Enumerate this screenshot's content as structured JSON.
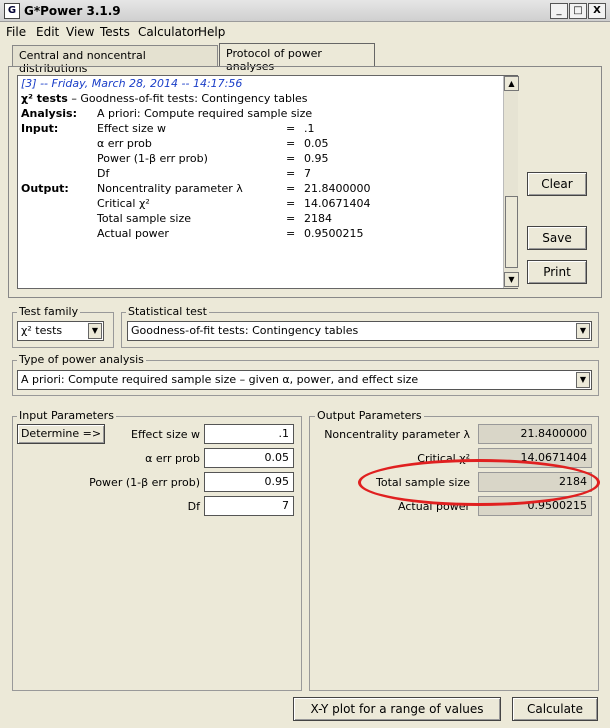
{
  "window": {
    "title": "G*Power 3.1.9",
    "app_icon": "gpower-logo-icon",
    "controls": [
      "_",
      "□",
      "X"
    ]
  },
  "menu": [
    "File",
    "Edit",
    "View",
    "Tests",
    "Calculator",
    "Help"
  ],
  "tabs": [
    "Central and noncentral distributions",
    "Protocol of power analyses"
  ],
  "protocol": {
    "header": "[3]  -- Friday, March 28, 2014 -- 14:17:56",
    "test_title_bold": "χ² tests",
    "test_title_rest": "  –  Goodness-of-fit tests: Contingency tables",
    "analysis_label": "Analysis:",
    "analysis_value": "A priori: Compute required sample size",
    "input_label": "Input:",
    "output_label": "Output:",
    "inputs": [
      {
        "name": "Effect size w",
        "eq": "=",
        "value": ".1"
      },
      {
        "name": "α err prob",
        "eq": "=",
        "value": "0.05"
      },
      {
        "name": "Power (1-β err prob)",
        "eq": "=",
        "value": "0.95"
      },
      {
        "name": "Df",
        "eq": "=",
        "value": "7"
      }
    ],
    "outputs": [
      {
        "name": "Noncentrality parameter λ",
        "eq": "=",
        "value": "21.8400000"
      },
      {
        "name": "Critical χ²",
        "eq": "=",
        "value": "14.0671404"
      },
      {
        "name": "Total sample size",
        "eq": "=",
        "value": "2184"
      },
      {
        "name": "Actual power",
        "eq": "=",
        "value": "0.9500215"
      }
    ]
  },
  "side_buttons": {
    "clear": "Clear",
    "save": "Save",
    "print": "Print"
  },
  "test_family": {
    "label": "Test family",
    "value": "χ² tests"
  },
  "statistical_test": {
    "label": "Statistical test",
    "value": "Goodness-of-fit tests: Contingency tables"
  },
  "power_analysis": {
    "label": "Type of power analysis",
    "value": "A priori: Compute required sample size – given α, power, and effect size"
  },
  "input_params": {
    "label": "Input Parameters",
    "determine": "Determine =>",
    "fields": [
      {
        "label": "Effect size w",
        "value": ".1"
      },
      {
        "label": "α err prob",
        "value": "0.05"
      },
      {
        "label": "Power (1-β err prob)",
        "value": "0.95"
      },
      {
        "label": "Df",
        "value": "7"
      }
    ]
  },
  "output_params": {
    "label": "Output Parameters",
    "fields": [
      {
        "label": "Noncentrality parameter λ",
        "value": "21.8400000"
      },
      {
        "label": "Critical χ²",
        "value": "14.0671404"
      },
      {
        "label": "Total sample size",
        "value": "2184"
      },
      {
        "label": "Actual power",
        "value": "0.9500215"
      }
    ]
  },
  "bottom_buttons": {
    "xy_plot": "X-Y plot for a range of values",
    "calculate": "Calculate"
  },
  "highlight_color": "#e02020"
}
